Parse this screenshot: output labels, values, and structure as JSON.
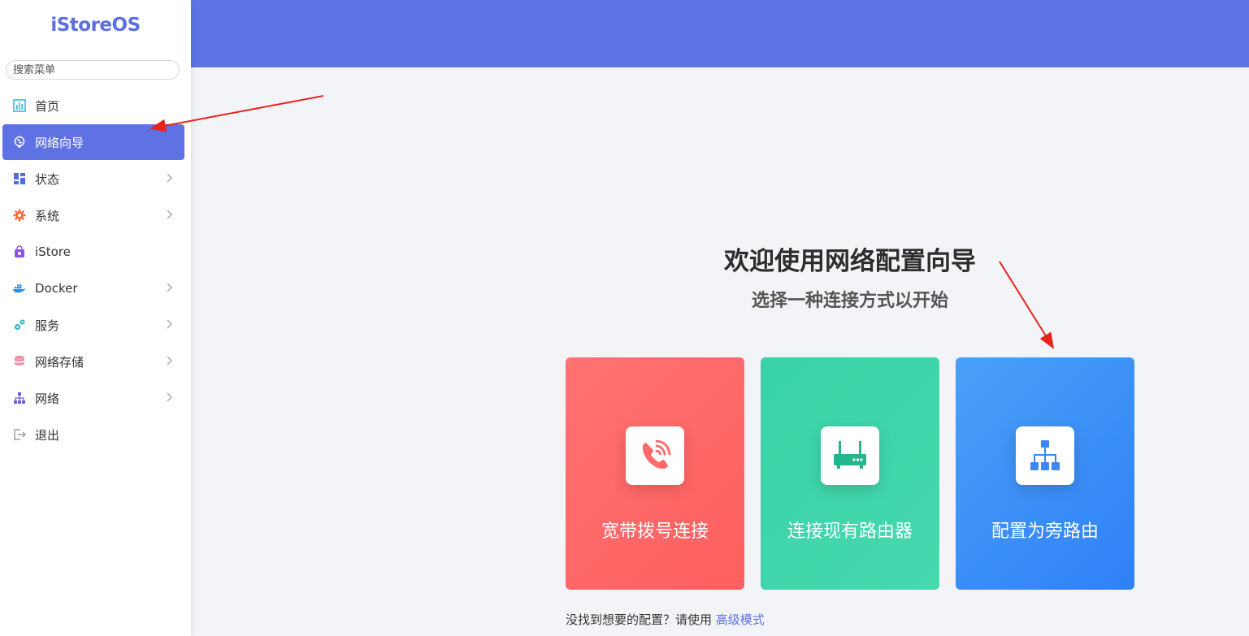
{
  "app": {
    "logo_text": "iStoreOS"
  },
  "search": {
    "placeholder": "搜索菜单"
  },
  "sidebar": {
    "items": [
      {
        "label": "首页",
        "icon": "dashboard-chart-icon",
        "has_submenu": false
      },
      {
        "label": "网络向导",
        "icon": "globe-icon",
        "has_submenu": false,
        "active": true
      },
      {
        "label": "状态",
        "icon": "grid-icon",
        "has_submenu": true
      },
      {
        "label": "系统",
        "icon": "gear-icon",
        "has_submenu": true
      },
      {
        "label": "iStore",
        "icon": "bag-icon",
        "has_submenu": false
      },
      {
        "label": "Docker",
        "icon": "docker-icon",
        "has_submenu": true
      },
      {
        "label": "服务",
        "icon": "gears-icon",
        "has_submenu": true
      },
      {
        "label": "网络存储",
        "icon": "database-icon",
        "has_submenu": true
      },
      {
        "label": "网络",
        "icon": "network-tree-icon",
        "has_submenu": true
      },
      {
        "label": "退出",
        "icon": "logout-icon",
        "has_submenu": false
      }
    ]
  },
  "main": {
    "title": "欢迎使用网络配置向导",
    "subtitle": "选择一种连接方式以开始",
    "cards": [
      {
        "label": "宽带拨号连接",
        "icon": "phone-call-icon",
        "color": "#ff6b6b"
      },
      {
        "label": "连接现有路由器",
        "icon": "router-icon",
        "color": "#3ed5a9"
      },
      {
        "label": "配置为旁路由",
        "icon": "network-hierarchy-icon",
        "color": "#3d8ef7"
      }
    ],
    "footer_text": "没找到想要的配置？请使用 ",
    "footer_link": "高级模式"
  },
  "colors": {
    "accent": "#5f72e4",
    "header": "#5f74e4",
    "annotation_arrow": "#e8231c"
  }
}
